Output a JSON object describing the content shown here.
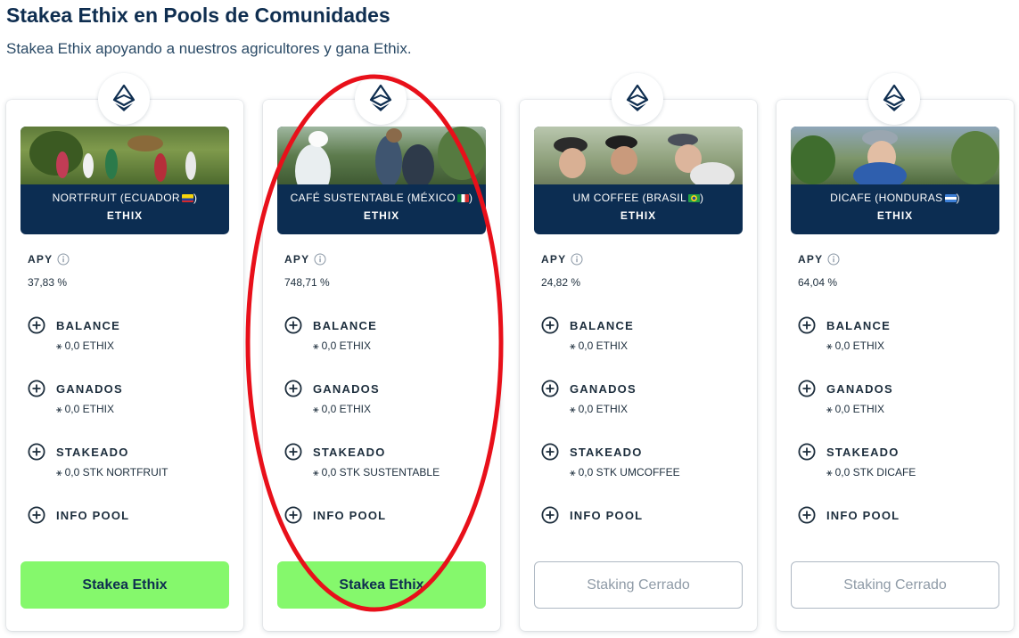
{
  "page": {
    "title": "Stakea Ethix en Pools de Comunidades",
    "subtitle": "Stakea Ethix apoyando a nuestros agricultores y gana Ethix."
  },
  "labels": {
    "apy": "APY",
    "balance": "BALANCE",
    "ganados": "GANADOS",
    "stakeado": "STAKEADO",
    "info_pool": "INFO POOL"
  },
  "cards": [
    {
      "name": "NORTFRUIT (ECUADOR",
      "flag": "ecuador",
      "token": "ETHIX",
      "apy": "37,83 %",
      "balance": "0,0 ETHIX",
      "ganados": "0,0 ETHIX",
      "stakeado": "0,0 STK NORTFRUIT",
      "button": "Stakea Ethix",
      "button_state": "active"
    },
    {
      "name": "CAFÉ SUSTENTABLE (MÉXICO",
      "flag": "mexico",
      "token": "ETHIX",
      "apy": "748,71 %",
      "balance": "0,0 ETHIX",
      "ganados": "0,0 ETHIX",
      "stakeado": "0,0 STK SUSTENTABLE",
      "button": "Stakea Ethix",
      "button_state": "active"
    },
    {
      "name": "UM COFFEE (BRASIL",
      "flag": "brasil",
      "token": "ETHIX",
      "apy": "24,82 %",
      "balance": "0,0 ETHIX",
      "ganados": "0,0 ETHIX",
      "stakeado": "0,0 STK UMCOFFEE",
      "button": "Staking Cerrado",
      "button_state": "closed"
    },
    {
      "name": "DICAFE (HONDURAS",
      "flag": "honduras",
      "token": "ETHIX",
      "apy": "64,04 %",
      "balance": "0,0 ETHIX",
      "ganados": "0,0 ETHIX",
      "stakeado": "0,0 STK DICAFE",
      "button": "Staking Cerrado",
      "button_state": "closed"
    }
  ],
  "icons": {
    "card_top": "ethix-logo-icon",
    "apy_info": "info-circle-icon",
    "row_expand": "plus-circle-icon",
    "value_symbol": "ethix-symbol-icon"
  },
  "colors": {
    "navy": "#0c2d52",
    "button_active": "#85f86c",
    "button_closed_border": "#aeb8c3",
    "highlight": "#e8101a"
  }
}
